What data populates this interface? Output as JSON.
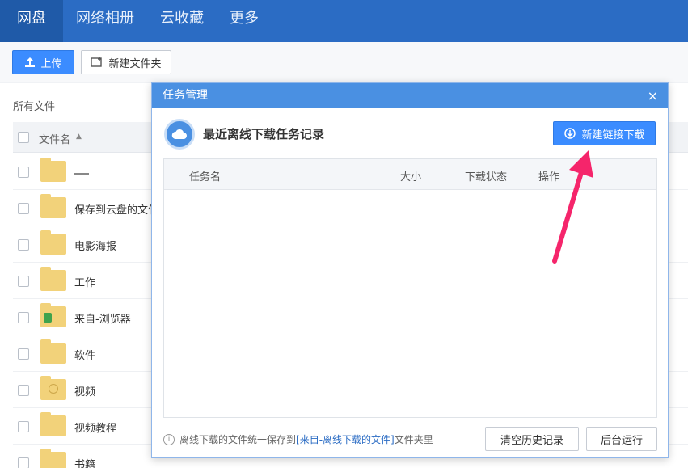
{
  "nav": {
    "tabs": [
      {
        "label": "网盘"
      },
      {
        "label": "网络相册"
      },
      {
        "label": "云收藏"
      },
      {
        "label": "更多"
      }
    ]
  },
  "toolbar": {
    "upload_label": "上传",
    "newfolder_label": "新建文件夹"
  },
  "files": {
    "breadcrumb": "所有文件",
    "column_name": "文件名",
    "rows": [
      {
        "name": ""
      },
      {
        "name": "保存到云盘的文件"
      },
      {
        "name": "电影海报"
      },
      {
        "name": "工作"
      },
      {
        "name": "来自-浏览器"
      },
      {
        "name": "软件"
      },
      {
        "name": "视频"
      },
      {
        "name": "视频教程"
      },
      {
        "name": "书籍"
      }
    ]
  },
  "modal": {
    "title": "任务管理",
    "close": "×",
    "section_title": "最近离线下载任务记录",
    "new_link_label": "新建链接下载",
    "table_headers": {
      "name": "任务名",
      "size": "大小",
      "status": "下载状态",
      "action": "操作"
    },
    "footer_prefix": "离线下载的文件统一保存到",
    "footer_link": "[来自-离线下载的文件]",
    "footer_suffix": "文件夹里",
    "clear_history_label": "清空历史记录",
    "background_run_label": "后台运行"
  },
  "colors": {
    "nav": "#2b6cc4",
    "primary": "#3b8cff",
    "modal_header": "#4a90e2",
    "arrow": "#f5256b"
  }
}
